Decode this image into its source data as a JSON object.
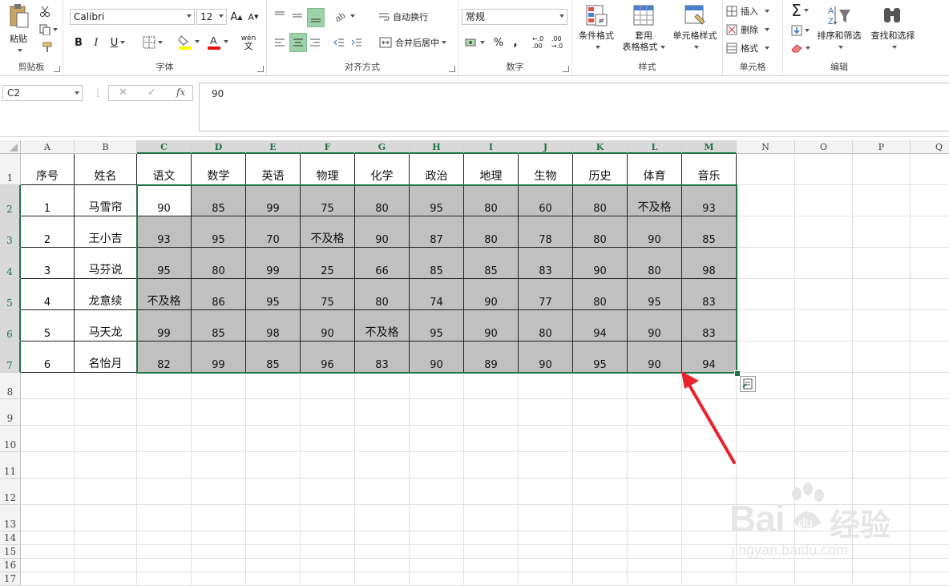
{
  "ribbon": {
    "clipboard": {
      "paste": "粘贴",
      "label": "剪贴板"
    },
    "font": {
      "name": "Calibri",
      "size": "12",
      "bold": "B",
      "italic": "I",
      "underline": "U",
      "phonetic": "wén",
      "grow": "A",
      "shrink": "A",
      "label": "字体"
    },
    "alignment": {
      "wrap": "自动换行",
      "merge": "合并后居中",
      "label": "对齐方式"
    },
    "number": {
      "format": "常规",
      "percent": "%",
      "comma": ",",
      "label": "数字"
    },
    "styles": {
      "conditional": "条件格式",
      "table_l1": "套用",
      "table_l2": "表格格式",
      "cell_styles": "单元格样式",
      "label": "样式"
    },
    "cells": {
      "insert": "插入",
      "delete": "删除",
      "format": "格式",
      "label": "单元格"
    },
    "editing": {
      "sort": "排序和筛选",
      "find": "查找和选择",
      "label": "编辑"
    }
  },
  "formula_bar": {
    "name_box": "C2",
    "fx": "fx",
    "value": "90"
  },
  "columns": [
    "A",
    "B",
    "C",
    "D",
    "E",
    "F",
    "G",
    "H",
    "I",
    "J",
    "K",
    "L",
    "M",
    "N",
    "O",
    "P",
    "Q"
  ],
  "selected_columns": [
    "C",
    "D",
    "E",
    "F",
    "G",
    "H",
    "I",
    "J",
    "K",
    "L",
    "M"
  ],
  "rows": [
    "1",
    "2",
    "3",
    "4",
    "5",
    "6",
    "7",
    "8",
    "9",
    "10",
    "11",
    "12",
    "13",
    "14",
    "15",
    "16",
    "17"
  ],
  "selected_rows": [
    "2",
    "3",
    "4",
    "5",
    "6",
    "7"
  ],
  "table": {
    "headers": [
      "序号",
      "姓名",
      "语文",
      "数学",
      "英语",
      "物理",
      "化学",
      "政治",
      "地理",
      "生物",
      "历史",
      "体育",
      "音乐"
    ],
    "rows": [
      [
        "1",
        "马雪帘",
        "90",
        "85",
        "99",
        "75",
        "80",
        "95",
        "80",
        "60",
        "80",
        "不及格",
        "93"
      ],
      [
        "2",
        "王小吉",
        "93",
        "95",
        "70",
        "不及格",
        "90",
        "87",
        "80",
        "78",
        "80",
        "90",
        "85"
      ],
      [
        "3",
        "马芬说",
        "95",
        "80",
        "99",
        "25",
        "66",
        "85",
        "85",
        "83",
        "90",
        "80",
        "98"
      ],
      [
        "4",
        "龙意续",
        "不及格",
        "86",
        "95",
        "75",
        "80",
        "74",
        "90",
        "77",
        "80",
        "95",
        "83"
      ],
      [
        "5",
        "马天龙",
        "99",
        "85",
        "98",
        "90",
        "不及格",
        "95",
        "90",
        "80",
        "94",
        "90",
        "83"
      ],
      [
        "6",
        "名怡月",
        "82",
        "99",
        "85",
        "96",
        "83",
        "90",
        "89",
        "90",
        "95",
        "90",
        "94"
      ]
    ]
  },
  "colors": {
    "selection": "#217346",
    "highlight": "#c0c0c0",
    "arrow": "#e8232a"
  },
  "watermark": {
    "brand": "Bai",
    "du_mark": "du",
    "cn": "经验",
    "url": "jingyan.baidu.com"
  }
}
